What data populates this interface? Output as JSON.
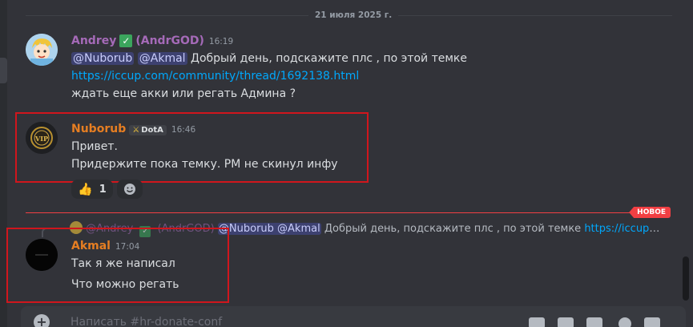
{
  "date_divider": "21 июля 2025 г.",
  "messages": [
    {
      "username": "Andrey",
      "username_color": "#a56ab8",
      "alias": "(AndrGOD)",
      "time": "16:19",
      "mention1": "@Nuborub",
      "mention2": "@Akmal",
      "line1_text": " Добрый день, подскажите плс , по этой темке",
      "link": "https://iccup.com/community/thread/1692138.html",
      "line3": "ждать еще акки или регать Админа ?"
    },
    {
      "username": "Nuborub",
      "username_color": "#e67e22",
      "role": "DotA",
      "time": "16:46",
      "line1": "Привет.",
      "line2": "Придержите пока темку. РМ не скинул инфу",
      "reaction_count": "1"
    },
    {
      "username": "Akmal",
      "username_color": "#e67e22",
      "time": "17:04",
      "line1": "Так я же написал",
      "line2": "Что можно регать"
    }
  ],
  "new_badge": "НОВОЕ",
  "reply": {
    "name": "@Andrey",
    "alias": "(AndrGOD)",
    "mention": "@Nuborub @Akmal",
    "text": " Добрый день, подскажите плс , по этой темке ",
    "link": "https://iccup.com/co..."
  },
  "input": {
    "placeholder": "Написать #hr-donate-conf"
  },
  "colors": {
    "highlight": "#d0161d",
    "accent_new": "#f23f43"
  }
}
